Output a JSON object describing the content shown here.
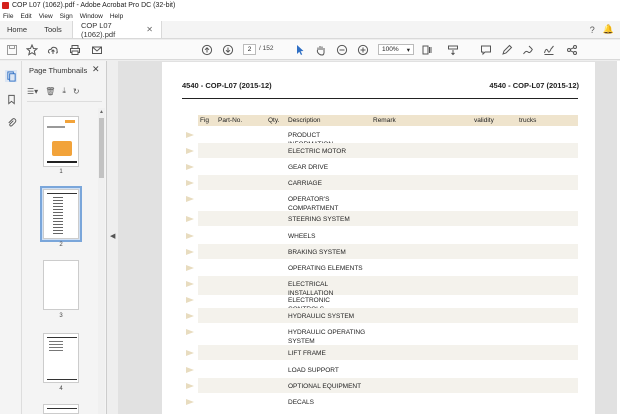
{
  "window": {
    "title": "COP L07 (1062).pdf - Adobe Acrobat Pro DC (32-bit)"
  },
  "menu": [
    "File",
    "Edit",
    "View",
    "Sign",
    "Window",
    "Help"
  ],
  "tabs": {
    "home": "Home",
    "tools": "Tools",
    "document": "COP L07 (1062).pdf"
  },
  "toolbar": {
    "current_page": "2",
    "total_pages": "/ 152",
    "zoom": "100%"
  },
  "thumbnails": {
    "title": "Page Thumbnails",
    "pages": [
      "1",
      "2",
      "3",
      "4"
    ]
  },
  "document": {
    "header_left": "4540 - COP-L07 (2015-12)",
    "header_right": "4540 - COP-L07 (2015-12)",
    "columns": {
      "fig": "Fig",
      "part_no": "Part-No.",
      "qty": "Qty.",
      "description": "Description",
      "remark": "Remark",
      "validity": "validity",
      "trucks": "trucks"
    },
    "rows": [
      "PRODUCT INFORMATION",
      "ELECTRIC MOTOR",
      "GEAR DRIVE",
      "CARRIAGE",
      "OPERATOR'S COMPARTMENT",
      "STEERING SYSTEM",
      "WHEELS",
      "BRAKING SYSTEM",
      "OPERATING ELEMENTS",
      "ELECTRICAL INSTALLATION",
      "ELECTRONIC CONTROLS",
      "HYDRAULIC SYSTEM",
      "HYDRAULIC OPERATING SYSTEM",
      "LIFT FRAME",
      "LOAD SUPPORT",
      "OPTIONAL EQUIPMENT",
      "DECALS"
    ]
  },
  "colors": {
    "accent": "#d4211c",
    "table_header": "#efe4cd",
    "row_shade": "#f4f2ec",
    "selection": "#7aa6da",
    "arrow": "#e8dcbf"
  }
}
